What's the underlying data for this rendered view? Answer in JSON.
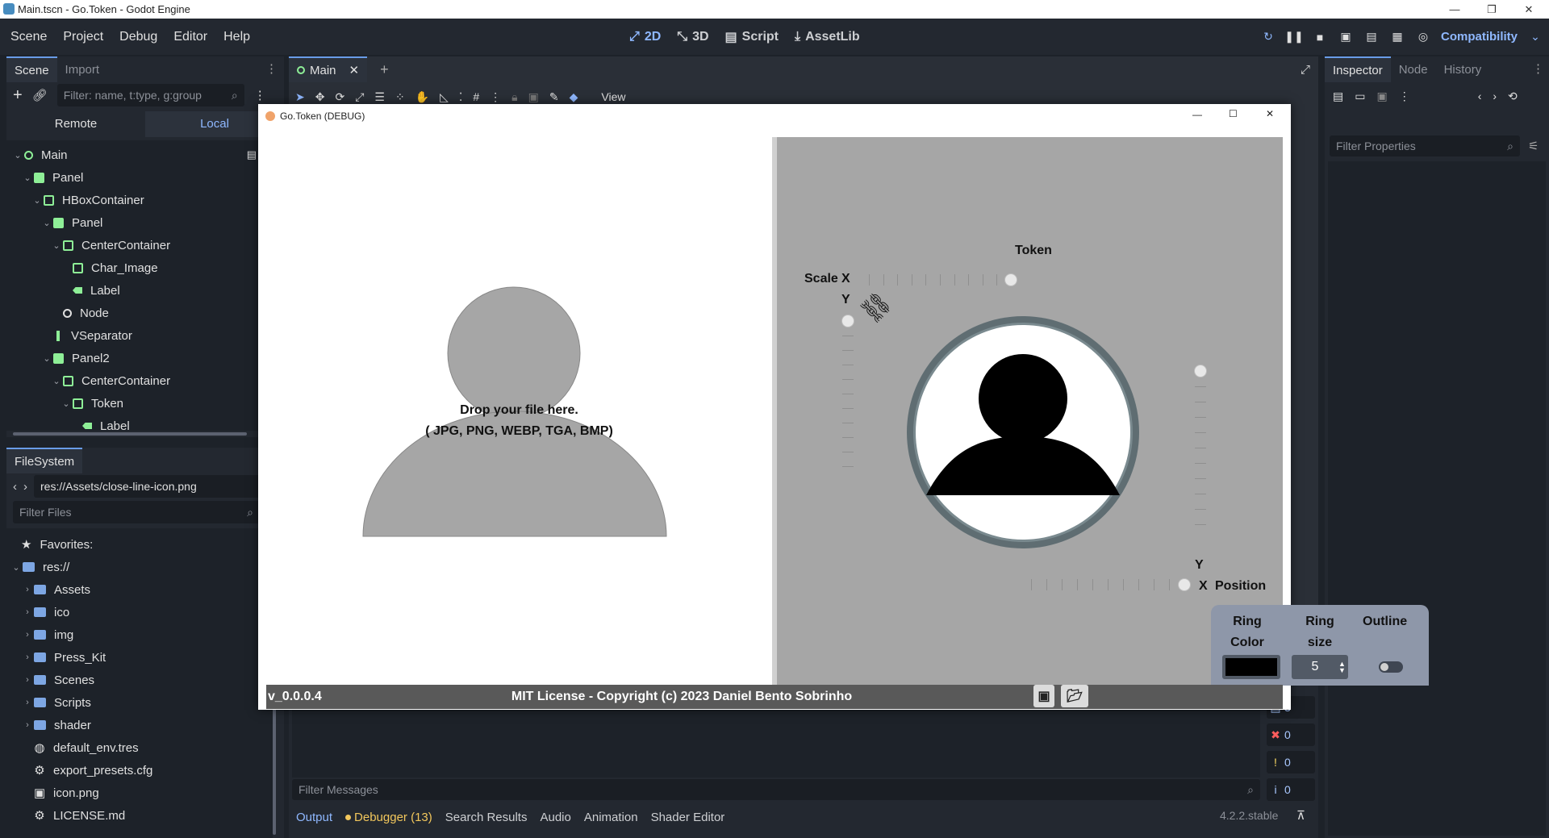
{
  "window": {
    "title": "Main.tscn - Go.Token - Godot Engine",
    "controls": [
      "—",
      "❐",
      "✕"
    ]
  },
  "menu": [
    "Scene",
    "Project",
    "Debug",
    "Editor",
    "Help"
  ],
  "workspaces": [
    "2D",
    "3D",
    "Script",
    "AssetLib"
  ],
  "renderer": "Compatibility",
  "scene_dock": {
    "tabs": [
      "Scene",
      "Import"
    ],
    "filter_placeholder": "Filter: name, t:type, g:group",
    "remote": "Remote",
    "local": "Local",
    "nodes": [
      {
        "label": "Main",
        "depth": 0,
        "kind": "node2d",
        "caret": "v"
      },
      {
        "label": "Panel",
        "depth": 1,
        "kind": "control",
        "caret": "v"
      },
      {
        "label": "HBoxContainer",
        "depth": 2,
        "kind": "hbox",
        "caret": "v"
      },
      {
        "label": "Panel",
        "depth": 3,
        "kind": "control",
        "caret": "v"
      },
      {
        "label": "CenterContainer",
        "depth": 4,
        "kind": "center",
        "caret": "v"
      },
      {
        "label": "Char_Image",
        "depth": 5,
        "kind": "texture",
        "caret": ""
      },
      {
        "label": "Label",
        "depth": 5,
        "kind": "label",
        "caret": ""
      },
      {
        "label": "Node",
        "depth": 4,
        "kind": "node",
        "caret": ""
      },
      {
        "label": "VSeparator",
        "depth": 3,
        "kind": "vsep",
        "caret": ""
      },
      {
        "label": "Panel2",
        "depth": 3,
        "kind": "control",
        "caret": "v"
      },
      {
        "label": "CenterContainer",
        "depth": 4,
        "kind": "center",
        "caret": "v"
      },
      {
        "label": "Token",
        "depth": 5,
        "kind": "vbox",
        "caret": "v"
      },
      {
        "label": "Label",
        "depth": 6,
        "kind": "label",
        "caret": ""
      }
    ]
  },
  "filesystem": {
    "tab": "FileSystem",
    "path": "res://Assets/close-line-icon.png",
    "filter_placeholder": "Filter Files",
    "favorites": "Favorites:",
    "root": "res://",
    "folders": [
      "Assets",
      "ico",
      "img",
      "Press_Kit",
      "Scenes",
      "Scripts",
      "shader"
    ],
    "files": [
      "default_env.tres",
      "export_presets.cfg",
      "icon.png",
      "LICENSE.md"
    ]
  },
  "editor": {
    "tab": "Main",
    "view_menu": "View"
  },
  "inspector": {
    "tabs": [
      "Inspector",
      "Node",
      "History"
    ],
    "filter_placeholder": "Filter Properties"
  },
  "bottom": {
    "filter_placeholder": "Filter Messages",
    "tabs": [
      "Output",
      "Debugger (13)",
      "Search Results",
      "Audio",
      "Animation",
      "Shader Editor"
    ],
    "version": "4.2.2.stable",
    "counts": [
      "3",
      "0",
      "0",
      "0"
    ]
  },
  "game": {
    "title": "Go.Token (DEBUG)",
    "drop_line1": "Drop your file here.",
    "drop_line2": "( JPG, PNG, WEBP, TGA, BMP)",
    "token_label": "Token",
    "scale_label": "Scale",
    "x_label": "X",
    "y_label": "Y",
    "position_label": "Position",
    "ring_color_label1": "Ring",
    "ring_color_label2": "Color",
    "ring_size_label1": "Ring",
    "ring_size_label2": "size",
    "outline_label": "Outline",
    "ring_size_value": "5",
    "ring_color": "#000000",
    "ring_outline_color": "#5f6d72",
    "version": "v_0.0.0.4",
    "license": "MIT License - Copyright (c) 2023 Daniel Bento Sobrinho",
    "scale_x": 1.0,
    "scale_y": 0.0,
    "position_x": 1.0,
    "position_y": 0.0,
    "outline_on": false
  },
  "colors": {
    "accent": "#699ce8",
    "node_green": "#8eef97",
    "editor_bg": "#1d2229"
  }
}
